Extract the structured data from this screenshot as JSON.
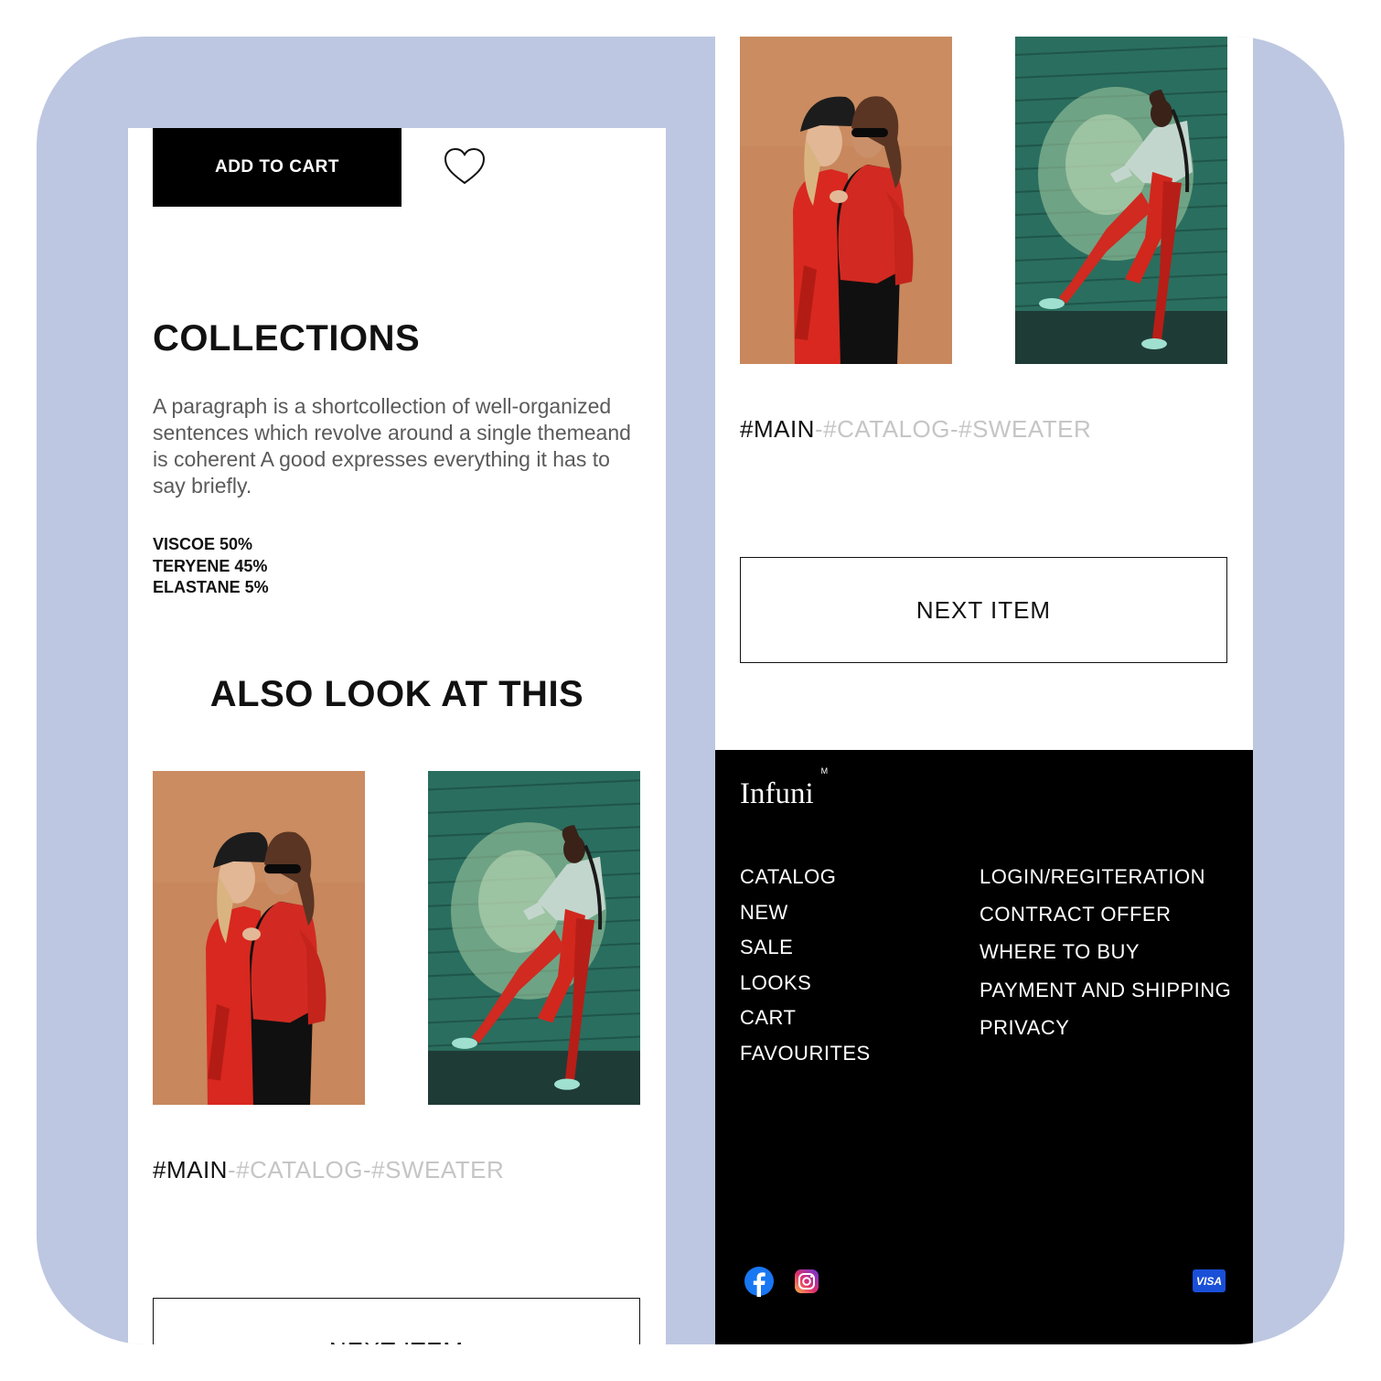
{
  "product": {
    "add_to_cart_label": "ADD TO CART",
    "collections_heading": "COLLECTIONS",
    "description": "A paragraph is a shortcollection of well-organized sentences which revolve around a single themeand is coherent A good expresses everything it has to say briefly.",
    "composition": [
      "VISCOE 50%",
      "TERYENE 45%",
      "ELASTANE 5%"
    ]
  },
  "recommendations": {
    "heading": "ALSO LOOK AT THIS"
  },
  "breadcrumb": {
    "current": "#MAIN",
    "rest": "-#CATALOG-#SWEATER"
  },
  "next_item_label": "NEXT ITEM",
  "footer": {
    "logo": "Infuni",
    "logo_mark": "M",
    "nav_left": [
      "CATALOG",
      "NEW",
      "SALE",
      "LOOKS",
      "CART",
      "FAVOURITES"
    ],
    "nav_right": [
      "LOGIN/REGITERATION",
      "CONTRACT OFFER",
      "WHERE TO BUY",
      "PAYMENT AND SHIPPING",
      "PRIVACY"
    ],
    "social": [
      "facebook-icon",
      "instagram-icon"
    ],
    "payment": "VISA"
  },
  "colors": {
    "frame_background": "#bdc7e1",
    "button_dark": "#000000",
    "breadcrumb_inactive": "#c5c5c5",
    "facebook_blue": "#1877f2",
    "visa_blue": "#1a4fd8"
  }
}
